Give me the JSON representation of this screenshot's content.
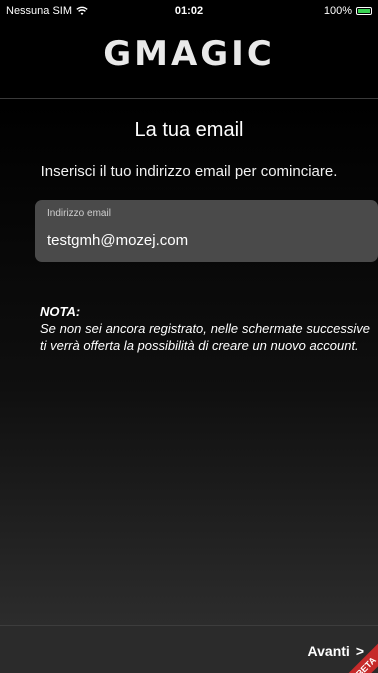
{
  "status_bar": {
    "carrier": "Nessuna SIM",
    "time": "01:02",
    "battery": "100%"
  },
  "header": {
    "logo": "GMAGIC"
  },
  "main": {
    "title": "La tua email",
    "subtitle": "Inserisci il tuo indirizzo email per cominciare.",
    "email_field": {
      "label": "Indirizzo email",
      "value": "testgmh@mozej.com"
    },
    "note": {
      "title": "NOTA:",
      "body": "Se non sei ancora registrato, nelle schermate successive ti verrà offerta la possibilità di creare un nuovo account."
    }
  },
  "footer": {
    "next_label": "Avanti",
    "next_arrow": ">",
    "badge": "BETA"
  },
  "colors": {
    "background": "#000000",
    "field_bg": "#4a4a4a",
    "footer_bg": "#2b2b2b",
    "badge": "#c62a2a"
  },
  "icons": {
    "wifi": "wifi-icon",
    "battery": "battery-icon"
  }
}
